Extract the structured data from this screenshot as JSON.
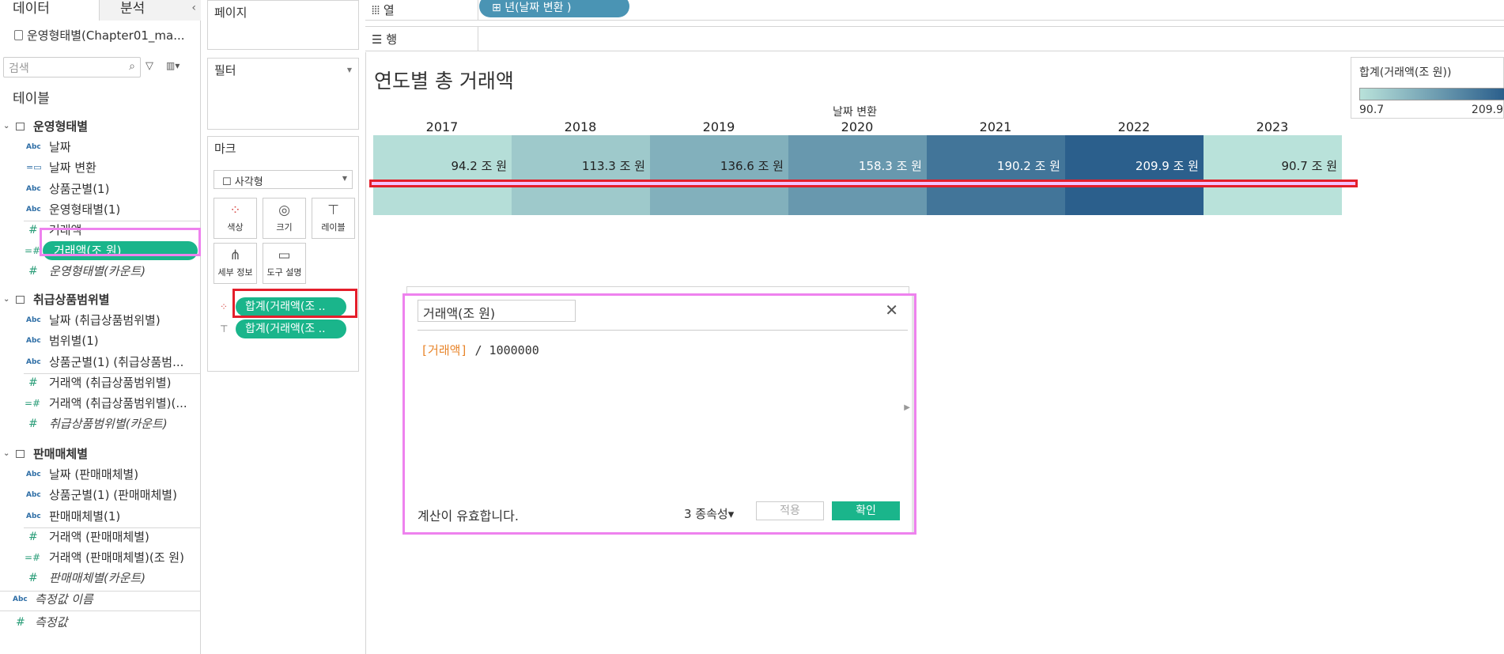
{
  "data_pane": {
    "tab_data": "데이터",
    "tab_analysis": "분석",
    "collapse_icon": "chevron-left-icon",
    "datasource": "운영형태별(Chapter01_ma...",
    "search_placeholder": "검색",
    "tables_label": "테이블",
    "groups": [
      {
        "name": "운영형태별",
        "fields": [
          {
            "label": "날짜",
            "type": "Abc"
          },
          {
            "label": "날짜 변환",
            "type": "date"
          },
          {
            "label": "상품군별(1)",
            "type": "Abc"
          },
          {
            "label": "운영형태별(1)",
            "type": "Abc"
          },
          {
            "label": "거래액",
            "type": "#"
          },
          {
            "label": "거래액(조 원)",
            "type": "=#"
          },
          {
            "label": "운영형태별(카운트)",
            "type": "#"
          }
        ]
      },
      {
        "name": "취급상품범위별",
        "fields": [
          {
            "label": "날짜 (취급상품범위별)",
            "type": "Abc"
          },
          {
            "label": "범위별(1)",
            "type": "Abc"
          },
          {
            "label": "상품군별(1) (취급상품범...",
            "type": "Abc"
          },
          {
            "label": "거래액 (취급상품범위별)",
            "type": "#"
          },
          {
            "label": "거래액 (취급상품범위별)(...",
            "type": "=#"
          },
          {
            "label": "취급상품범위별(카운트)",
            "type": "#"
          }
        ]
      },
      {
        "name": "판매매체별",
        "fields": [
          {
            "label": "날짜 (판매매체별)",
            "type": "Abc"
          },
          {
            "label": "상품군별(1) (판매매체별)",
            "type": "Abc"
          },
          {
            "label": "판매매체별(1)",
            "type": "Abc"
          },
          {
            "label": "거래액 (판매매체별)",
            "type": "#"
          },
          {
            "label": "거래액 (판매매체별)(조 원)",
            "type": "=#"
          },
          {
            "label": "판매매체별(카운트)",
            "type": "#"
          }
        ]
      }
    ],
    "measure_names": "측정값 이름",
    "measure_values": "측정값"
  },
  "pages_card": {
    "title": "페이지"
  },
  "filters_card": {
    "title": "필터"
  },
  "marks_card": {
    "title": "마크",
    "mark_type": "사각형",
    "buttons": [
      {
        "label": "색상",
        "icon": "color-dots-icon"
      },
      {
        "label": "크기",
        "icon": "size-icon"
      },
      {
        "label": "레이블",
        "icon": "label-icon"
      },
      {
        "label": "세부 정보",
        "icon": "detail-icon"
      },
      {
        "label": "도구 설명",
        "icon": "tooltip-icon"
      }
    ],
    "color_pill": "합계(거래액(조 ..",
    "label_pill": "합계(거래액(조 .."
  },
  "columns_shelf": {
    "label": "열",
    "pill": "년(날짜 변환 )"
  },
  "rows_shelf": {
    "label": "행"
  },
  "view": {
    "title": "연도별 총 거래액",
    "header": "날짜 변환"
  },
  "chart_data": {
    "type": "heatmap",
    "categories": [
      "2017",
      "2018",
      "2019",
      "2020",
      "2021",
      "2022",
      "2023"
    ],
    "values": [
      94.2,
      113.3,
      136.6,
      158.3,
      190.2,
      209.9,
      90.7
    ],
    "labels": [
      "94.2 조 원",
      "113.3 조 원",
      "136.6 조 원",
      "158.3 조 원",
      "190.2 조 원",
      "209.9 조 원",
      "90.7 조 원"
    ],
    "color_range": [
      90.7,
      209.9
    ],
    "color_low": "#b9e2da",
    "color_high": "#2b5f8c"
  },
  "legend": {
    "title": "합계(거래액(조 원))",
    "min": "90.7",
    "max": "209.9"
  },
  "calc_dialog": {
    "name": "거래액(조 원)",
    "formula_field": "[거래액]",
    "formula_rest": " / 1000000",
    "status": "계산이 유효합니다.",
    "dependencies": "3 종속성",
    "apply_label": "적용",
    "ok_label": "확인"
  },
  "colors": {
    "accent_green": "#1ab58b",
    "pill_blue": "#4a94b4",
    "highlight_red": "#e41e2b",
    "highlight_pink": "#ee82ee"
  }
}
